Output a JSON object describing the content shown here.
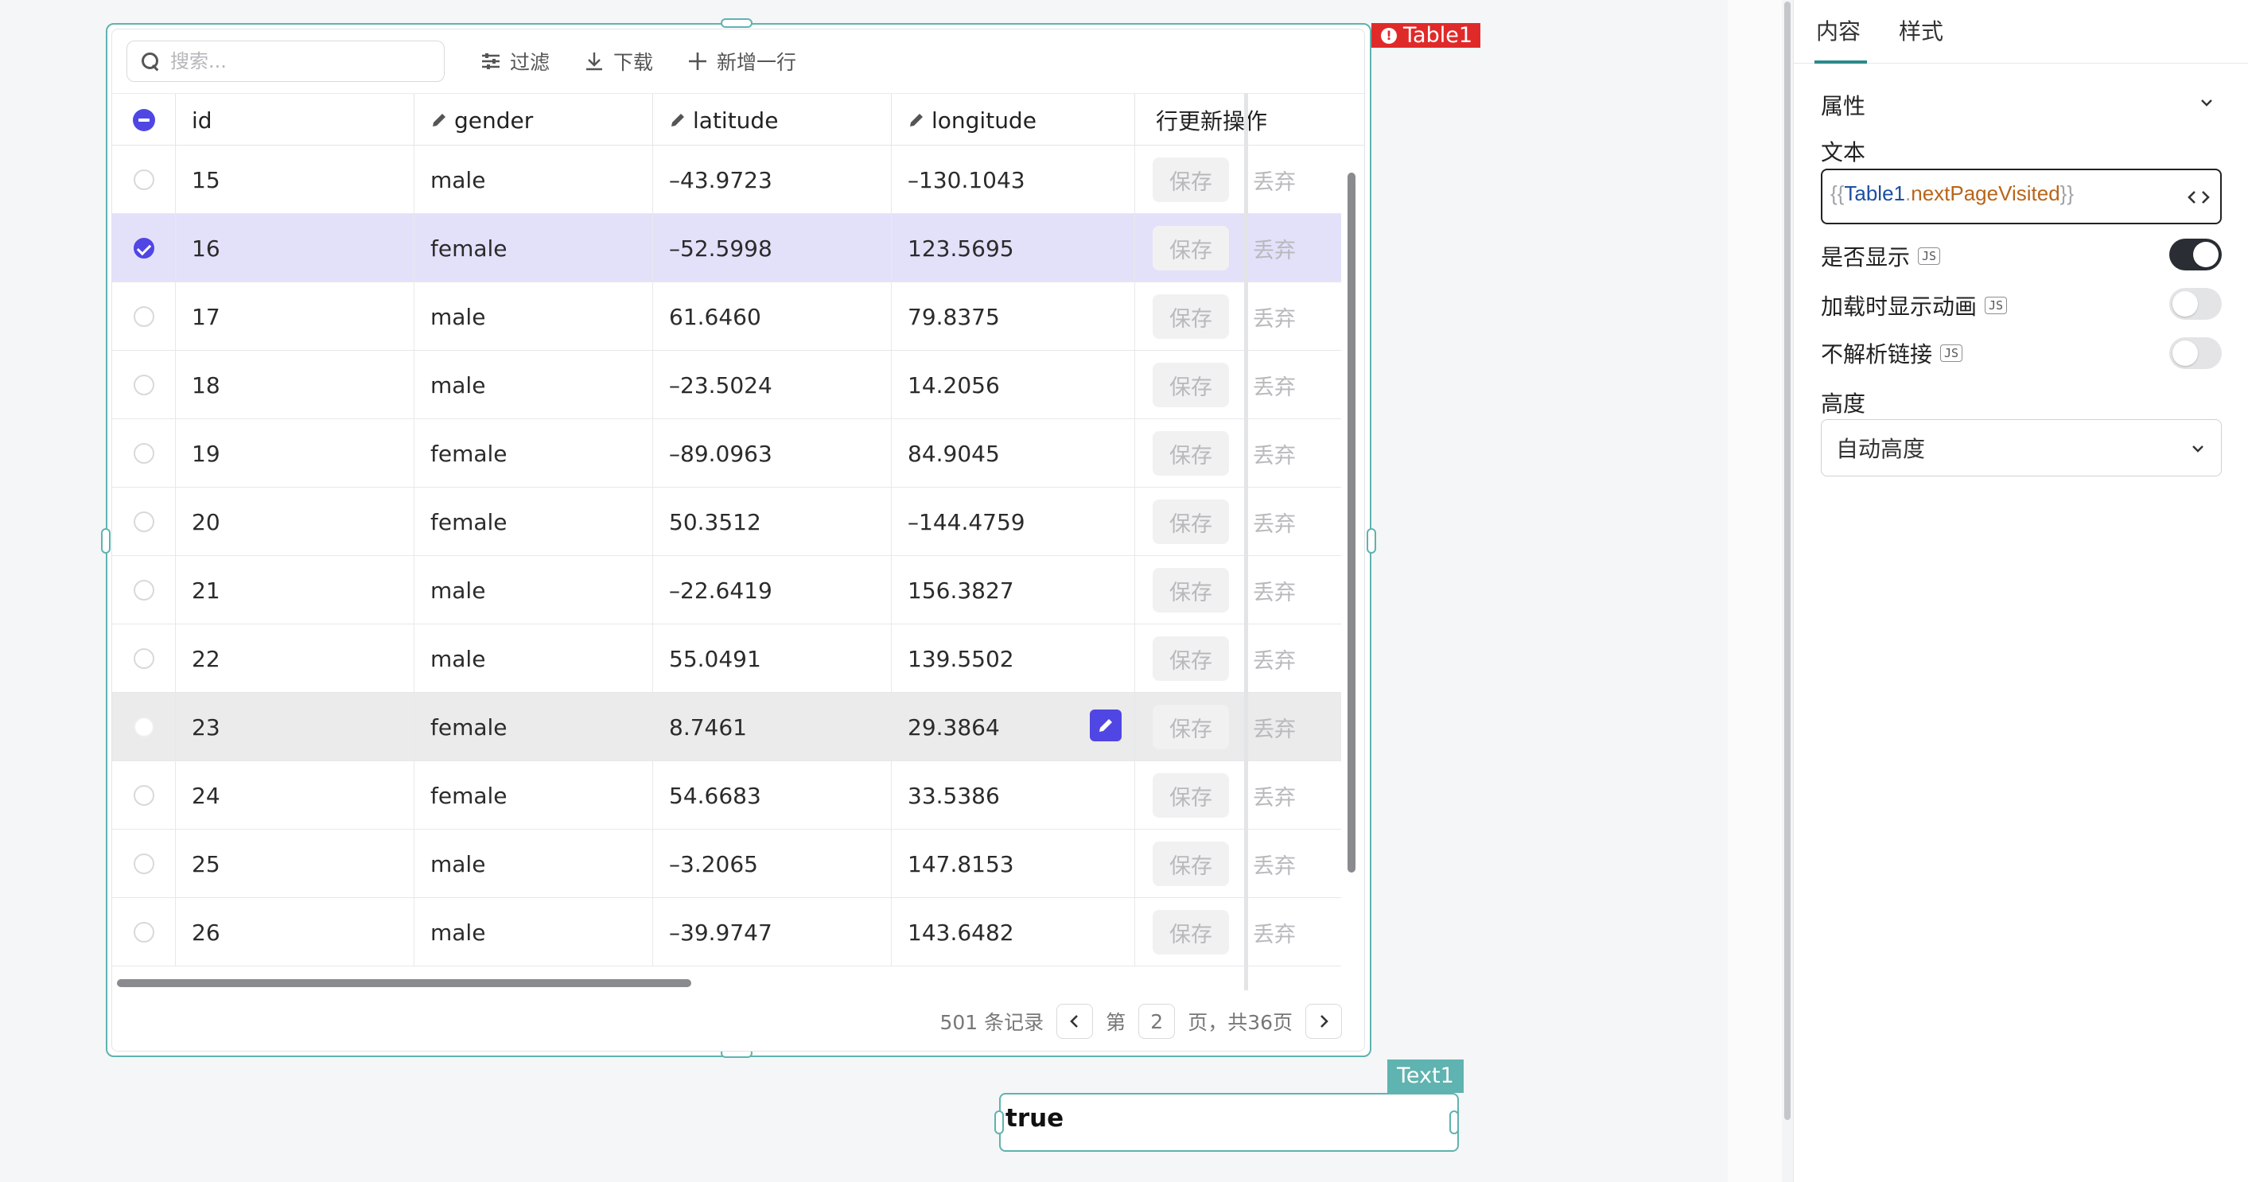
{
  "table_widget": {
    "tag_label": "Table1",
    "toolbar": {
      "search_placeholder": "搜索...",
      "filter_label": "过滤",
      "download_label": "下载",
      "add_row_label": "新增一行"
    },
    "columns": [
      {
        "key": "id",
        "label": "id",
        "editable": false
      },
      {
        "key": "gender",
        "label": "gender",
        "editable": true
      },
      {
        "key": "latitude",
        "label": "latitude",
        "editable": true
      },
      {
        "key": "longitude",
        "label": "longitude",
        "editable": true
      },
      {
        "key": "actions",
        "label": "行更新操作",
        "editable": false
      }
    ],
    "row_actions": {
      "save_label": "保存",
      "discard_label": "丢弃"
    },
    "rows": [
      {
        "id": "15",
        "gender": "male",
        "latitude": "–43.9723",
        "longitude": "–130.1043",
        "state": "normal"
      },
      {
        "id": "16",
        "gender": "female",
        "latitude": "–52.5998",
        "longitude": "123.5695",
        "state": "selected"
      },
      {
        "id": "17",
        "gender": "male",
        "latitude": "61.6460",
        "longitude": "79.8375",
        "state": "normal"
      },
      {
        "id": "18",
        "gender": "male",
        "latitude": "–23.5024",
        "longitude": "14.2056",
        "state": "normal"
      },
      {
        "id": "19",
        "gender": "female",
        "latitude": "–89.0963",
        "longitude": "84.9045",
        "state": "normal"
      },
      {
        "id": "20",
        "gender": "female",
        "latitude": "50.3512",
        "longitude": "–144.4759",
        "state": "normal"
      },
      {
        "id": "21",
        "gender": "male",
        "latitude": "–22.6419",
        "longitude": "156.3827",
        "state": "normal"
      },
      {
        "id": "22",
        "gender": "male",
        "latitude": "55.0491",
        "longitude": "139.5502",
        "state": "normal"
      },
      {
        "id": "23",
        "gender": "female",
        "latitude": "8.7461",
        "longitude": "29.3864",
        "state": "hover"
      },
      {
        "id": "24",
        "gender": "female",
        "latitude": "54.6683",
        "longitude": "33.5386",
        "state": "normal"
      },
      {
        "id": "25",
        "gender": "male",
        "latitude": "–3.2065",
        "longitude": "147.8153",
        "state": "normal"
      },
      {
        "id": "26",
        "gender": "male",
        "latitude": "–39.9747",
        "longitude": "143.6482",
        "state": "normal"
      }
    ],
    "footer": {
      "records_text": "501 条记录",
      "page_prefix": "第",
      "current_page": "2",
      "page_suffix": "页，共36页"
    }
  },
  "text_widget": {
    "tag_label": "Text1",
    "value": "true"
  },
  "panel": {
    "tabs": [
      {
        "label": "内容",
        "active": true
      },
      {
        "label": "样式",
        "active": false
      }
    ],
    "section_title": "属性",
    "text_label": "文本",
    "text_binding": {
      "open": "{{",
      "object": "Table1",
      "dot": ".",
      "property": "nextPageVisited",
      "close": "}}"
    },
    "js_badge": "JS",
    "toggles": [
      {
        "label": "是否显示",
        "on": true
      },
      {
        "label": "加载时显示动画",
        "on": false
      },
      {
        "label": "不解析链接",
        "on": false
      }
    ],
    "height_label": "高度",
    "height_value": "自动高度"
  },
  "colors": {
    "accent": "#5046e4",
    "widget_border": "#5fb3b0",
    "error_tag": "#e02a2a",
    "selected_row": "#e3e1fa"
  }
}
